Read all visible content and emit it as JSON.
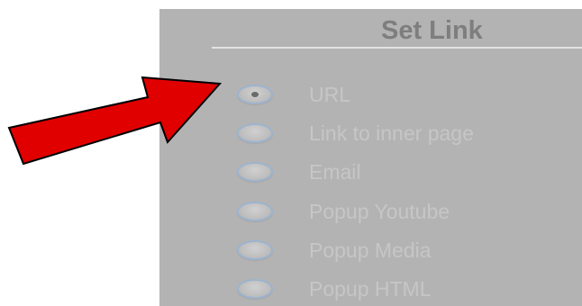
{
  "dialog": {
    "title": "Set Link",
    "options": [
      {
        "label": "URL",
        "selected": true
      },
      {
        "label": "Link to inner page",
        "selected": false
      },
      {
        "label": "Email",
        "selected": false
      },
      {
        "label": "Popup Youtube",
        "selected": false
      },
      {
        "label": "Popup Media",
        "selected": false
      },
      {
        "label": "Popup HTML",
        "selected": false
      }
    ]
  },
  "annotation": {
    "arrow_color": "#e00000",
    "icon": "pointer-arrow-icon"
  },
  "colors": {
    "panel_bg": "#b3b3b3",
    "title": "#7e7e7e",
    "option_text": "#c6c6c6"
  }
}
